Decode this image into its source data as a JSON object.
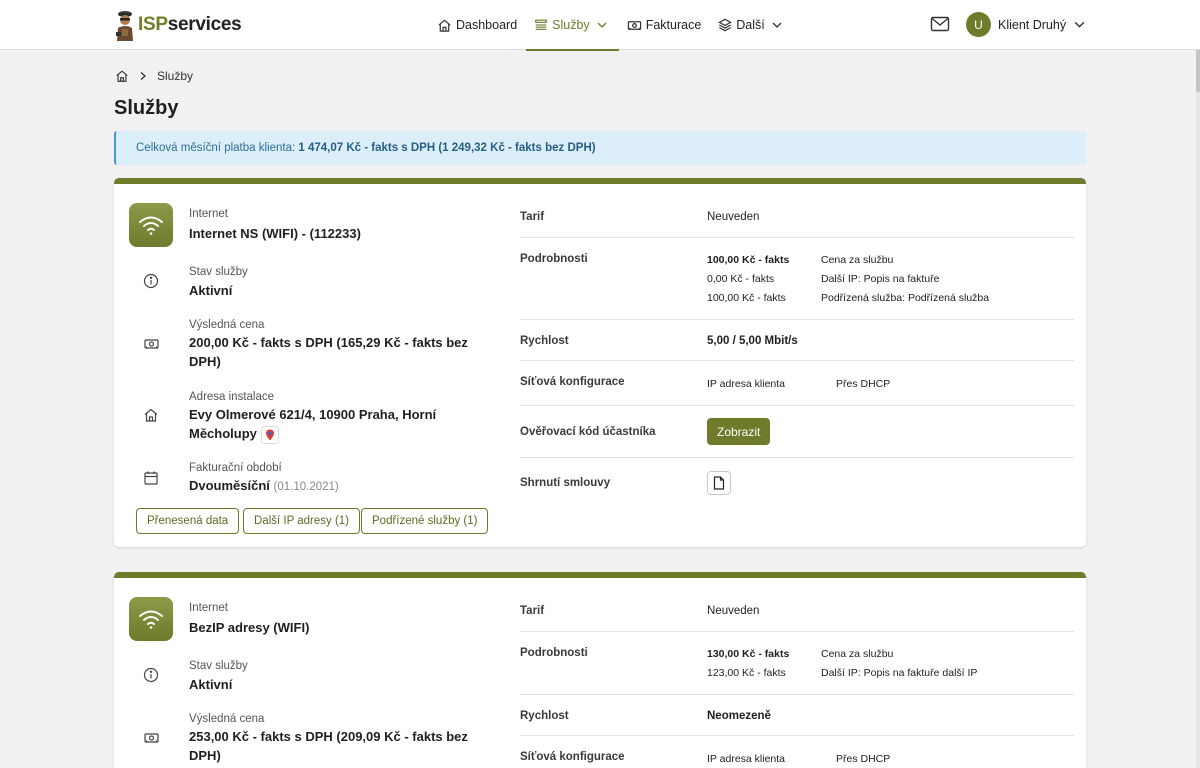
{
  "header": {
    "brand_prefix": "ISP",
    "brand_suffix": "services",
    "nav": [
      {
        "label": "Dashboard",
        "icon": "home-icon"
      },
      {
        "label": "Služby",
        "icon": "list-icon",
        "active": true
      },
      {
        "label": "Fakturace",
        "icon": "money-icon"
      },
      {
        "label": "Další",
        "icon": "layers-icon"
      }
    ],
    "user": {
      "initial": "U",
      "name": "Klient Druhý"
    }
  },
  "breadcrumb": {
    "current": "Služby"
  },
  "page": {
    "title": "Služby"
  },
  "alert": {
    "prefix": "Celková měsíční platba klienta: ",
    "amount": "1 474,07 Kč - fakts s DPH (1 249,32 Kč - fakts bez DPH)"
  },
  "cards": [
    {
      "type_label": "Internet",
      "name": "Internet NS (WIFI) - (112233)",
      "status_label": "Stav služby",
      "status": "Aktivní",
      "price_label": "Výsledná cena",
      "price_line1": "200,00 Kč - fakts s DPH (165,29 Kč - fakts bez",
      "price_line2": "DPH)",
      "address_label": "Adresa instalace",
      "address_line1": "Evy Olmerové 621/4, 10900 Praha, Horní",
      "address_line2": "Měcholupy",
      "billing_label": "Fakturační období",
      "billing": "Dvouměsíční",
      "billing_date": "(01.10.2021)",
      "buttons": [
        "Přenesená data",
        "Další IP adresy (1)",
        "Podřízené služby (1)"
      ],
      "tarif_label": "Tarif",
      "tarif": "Neuveden",
      "details_label": "Podrobnosti",
      "details": [
        {
          "amount": "100,00 Kč - fakts",
          "desc": "Cena za službu",
          "bold": true
        },
        {
          "amount": "0,00 Kč - fakts",
          "desc": "Další IP: Popis na faktuře",
          "bold": false
        },
        {
          "amount": "100,00 Kč - fakts",
          "desc": "Podřízená služba: Podřízená služba",
          "bold": false
        }
      ],
      "speed_label": "Rychlost",
      "speed": "5,00 / 5,00 Mbit/s",
      "netconf_label": "Síťová konfigurace",
      "netconf_key": "IP adresa klienta",
      "netconf_value": "Přes DHCP",
      "verify_label": "Ověřovací kód účastníka",
      "verify_button": "Zobrazit",
      "summary_label": "Shrnutí smlouvy"
    },
    {
      "type_label": "Internet",
      "name": "BezIP adresy (WIFI)",
      "status_label": "Stav služby",
      "status": "Aktivní",
      "price_label": "Výsledná cena",
      "price_line1": "253,00 Kč - fakts s DPH (209,09 Kč - fakts bez",
      "price_line2": "DPH)",
      "tarif_label": "Tarif",
      "tarif": "Neuveden",
      "details_label": "Podrobnosti",
      "details": [
        {
          "amount": "130,00 Kč - fakts",
          "desc": "Cena za službu",
          "bold": true
        },
        {
          "amount": "123,00 Kč - fakts",
          "desc": "Další IP: Popis na faktuře další IP",
          "bold": false
        }
      ],
      "speed_label": "Rychlost",
      "speed": "Neomezeně",
      "netconf_label": "Síťová konfigurace",
      "netconf_key": "IP adresa klienta",
      "netconf_value": "Přes DHCP"
    }
  ],
  "colors": {
    "accent": "#6f7b2b",
    "alert_bg": "#dceef9",
    "alert_text": "#2b6f98"
  }
}
